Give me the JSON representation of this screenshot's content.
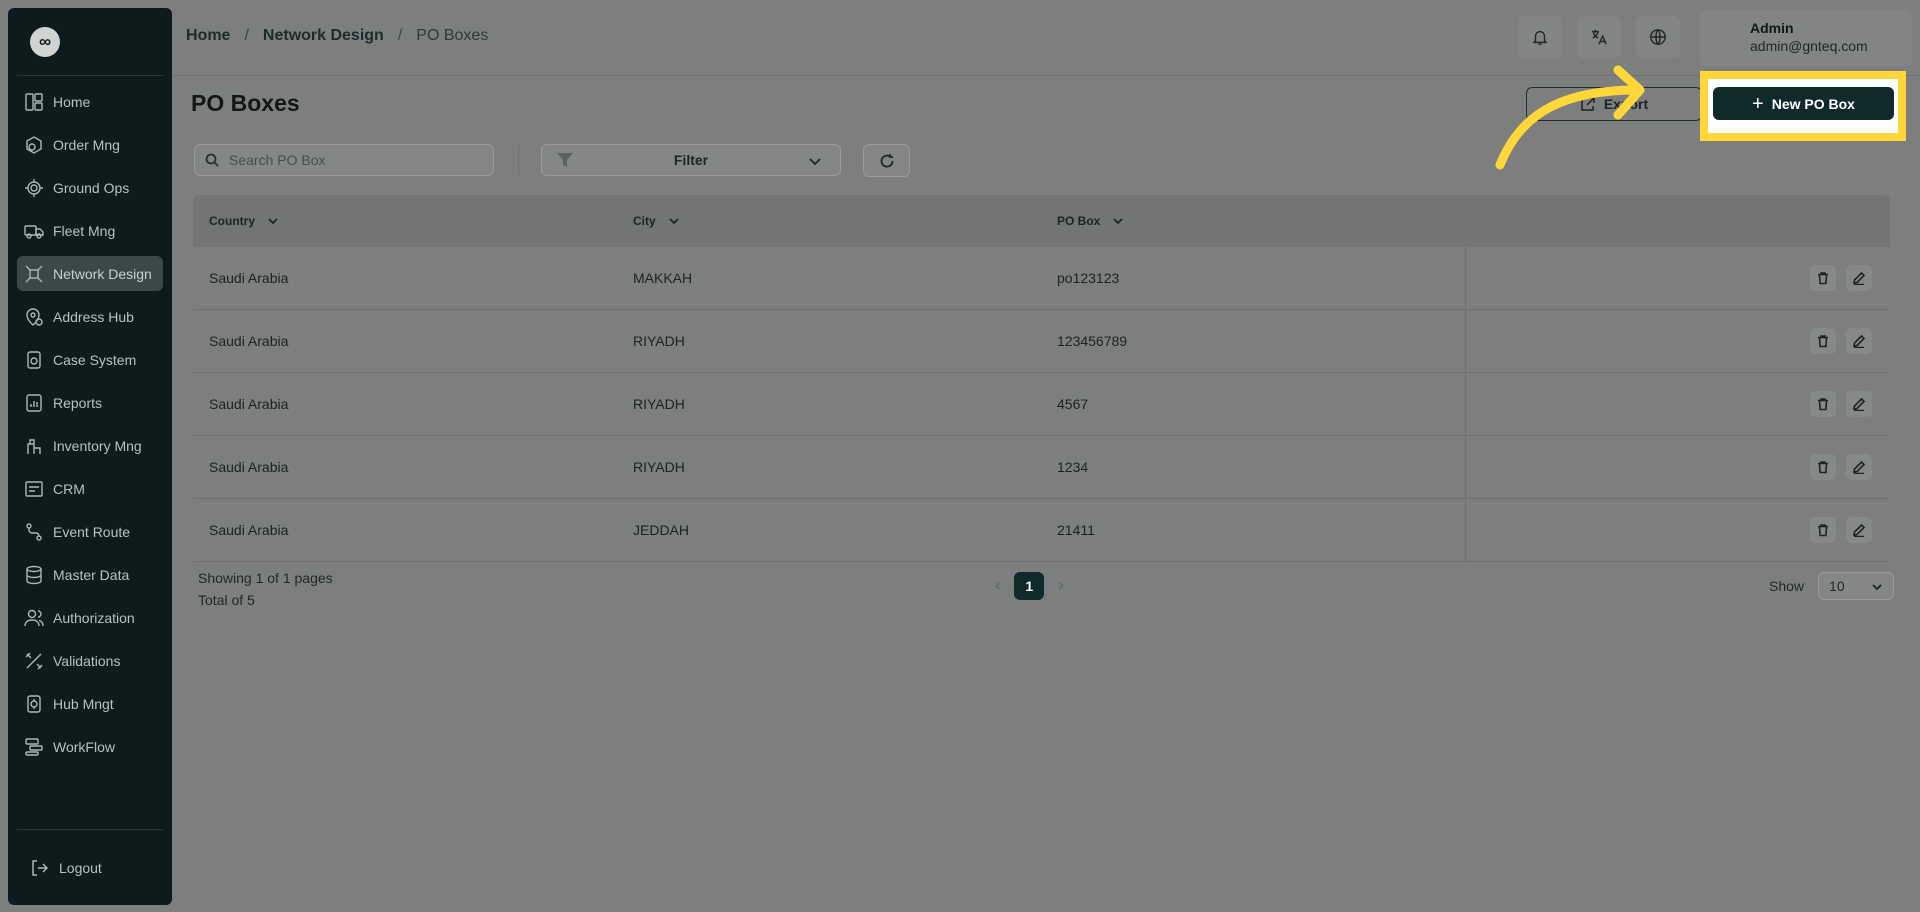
{
  "sidebar": {
    "logo": "∞",
    "items": [
      {
        "label": "Home",
        "icon": "home-icon"
      },
      {
        "label": "Order Mng",
        "icon": "order-icon"
      },
      {
        "label": "Ground Ops",
        "icon": "ground-ops-icon"
      },
      {
        "label": "Fleet Mng",
        "icon": "truck-icon"
      },
      {
        "label": "Network Design",
        "icon": "network-icon",
        "active": true
      },
      {
        "label": "Address Hub",
        "icon": "map-pin-icon"
      },
      {
        "label": "Case System",
        "icon": "case-icon"
      },
      {
        "label": "Reports",
        "icon": "report-icon"
      },
      {
        "label": "Inventory Mng",
        "icon": "inventory-icon"
      },
      {
        "label": "CRM",
        "icon": "crm-icon"
      },
      {
        "label": "Event Route",
        "icon": "route-icon"
      },
      {
        "label": "Master Data",
        "icon": "database-icon"
      },
      {
        "label": "Authorization",
        "icon": "users-icon"
      },
      {
        "label": "Validations",
        "icon": "validations-icon"
      },
      {
        "label": "Hub Mngt",
        "icon": "hub-icon"
      },
      {
        "label": "WorkFlow",
        "icon": "workflow-icon"
      }
    ],
    "logout": "Logout"
  },
  "header": {
    "breadcrumb": [
      "Home",
      "Network Design",
      "PO Boxes"
    ],
    "user_name": "Admin",
    "user_email": "admin@gnteq.com"
  },
  "main": {
    "title": "PO Boxes",
    "export_label": "Export",
    "new_label": "New PO Box",
    "search_placeholder": "Search PO Box",
    "filter_label": "Filter",
    "columns": [
      "Country",
      "City",
      "PO Box"
    ],
    "rows": [
      {
        "country": "Saudi Arabia",
        "city": "MAKKAH",
        "po_box": "po123123"
      },
      {
        "country": "Saudi Arabia",
        "city": "RIYADH",
        "po_box": "123456789"
      },
      {
        "country": "Saudi Arabia",
        "city": "RIYADH",
        "po_box": "4567"
      },
      {
        "country": "Saudi Arabia",
        "city": "RIYADH",
        "po_box": "1234"
      },
      {
        "country": "Saudi Arabia",
        "city": "JEDDAH",
        "po_box": "21411"
      }
    ],
    "showing": "Showing 1 of 1 pages",
    "total": "Total of 5",
    "current_page": "1",
    "show_label": "Show",
    "page_size": "10"
  },
  "colors": {
    "highlight": "#ffd73a",
    "primary": "#10292b",
    "sidebar_bg": "#0e1b1c"
  }
}
